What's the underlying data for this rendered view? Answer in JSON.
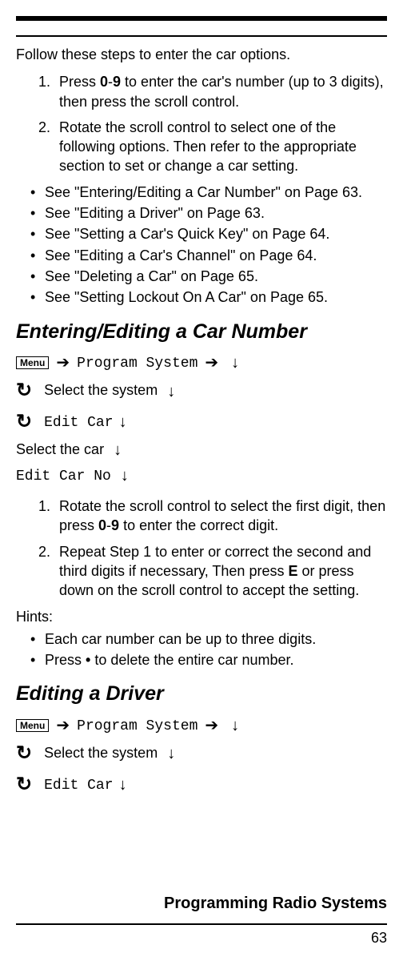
{
  "topbar": {},
  "intro": "Follow these steps to enter the car options.",
  "steps_main": {
    "s1_a": "Press ",
    "s1_key1": "0",
    "s1_dash": "-",
    "s1_key2": "9",
    "s1_b": " to enter the car's number (up to 3 digits), then press the scroll control.",
    "s2": "Rotate the scroll control to select one of the following options. Then refer to the appropriate section to set or change a car setting."
  },
  "refs": [
    "See \"Entering/Editing a Car Number\" on Page 63.",
    "See \"Editing a Driver\" on Page 63.",
    "See \"Setting a Car's Quick Key\" on Page 64.",
    "See \"Editing a Car's Channel\" on Page 64.",
    "See \"Deleting a Car\" on Page 65.",
    "See \"Setting Lockout On A Car\" on Page 65."
  ],
  "section1": {
    "title": "Entering/Editing a Car Number",
    "nav": {
      "menu": "Menu",
      "prog_sys": "Program System",
      "select_sys": "Select the system",
      "edit_car": "Edit Car",
      "select_car": "Select the car",
      "edit_car_no": "Edit Car No"
    },
    "steps": {
      "s1_a": "Rotate the scroll control to select the first digit, then press ",
      "s1_key1": "0",
      "s1_dash": "-",
      "s1_key2": "9",
      "s1_b": " to enter the correct digit.",
      "s2_a": "Repeat Step 1 to enter or correct the second and third digits if necessary, Then press ",
      "s2_key": "E",
      "s2_b": " or press down on the scroll control to accept the setting."
    },
    "hints_label": "Hints:",
    "hints": {
      "h1": "Each car number can be up to three digits.",
      "h2_a": "Press ",
      "h2_key": "•",
      "h2_b": " to delete the entire car number."
    }
  },
  "section2": {
    "title": "Editing a Driver",
    "nav": {
      "menu": "Menu",
      "prog_sys": "Program System",
      "select_sys": "Select the system",
      "edit_car": "Edit Car"
    }
  },
  "footer": {
    "title": "Programming Radio Systems",
    "page": "63"
  }
}
